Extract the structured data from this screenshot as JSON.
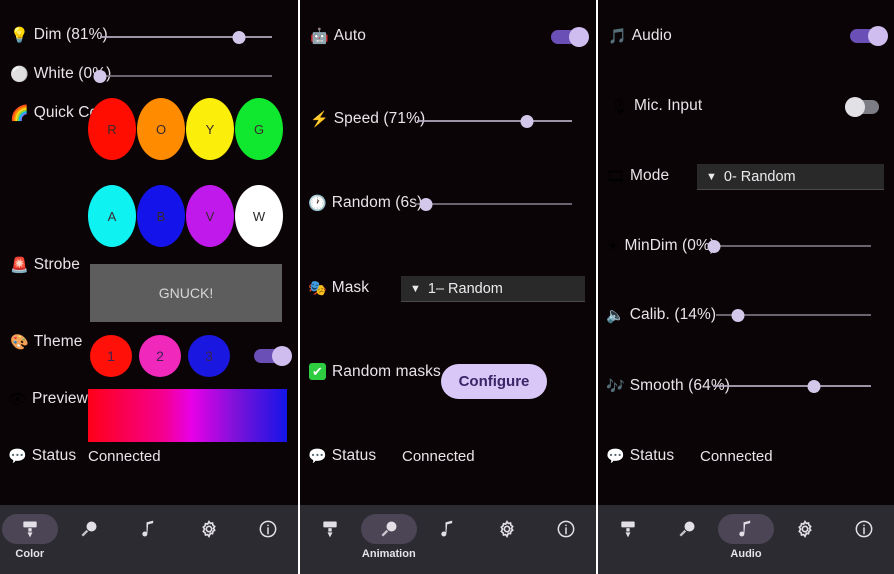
{
  "app": {
    "background": "#0b0406",
    "accent": "#cfbdf0",
    "navbar_bg": "#2c2b31"
  },
  "panels": [
    {
      "id": "color",
      "rows": {
        "dim": {
          "icon": "lightbulb-icon",
          "emoji": "💡",
          "label": "Dim (81%)",
          "value": 81
        },
        "white": {
          "icon": "white-circle-icon",
          "emoji": "⚪",
          "label": "White (0%)",
          "value": 0
        },
        "quick_col": {
          "icon": "rainbow-icon",
          "emoji": "🌈",
          "label": "Quick Col"
        },
        "strobe": {
          "icon": "siren-icon",
          "emoji": "🚨",
          "label": "Strobe",
          "button_label": "GNUCK!",
          "button_color": "#5d5d5d"
        },
        "theme": {
          "icon": "palette-icon",
          "emoji": "🎨",
          "label": "Theme",
          "toggle_on": true
        },
        "preview": {
          "icon": "eye-icon",
          "emoji": "👁",
          "label": "Preview",
          "gradient": [
            "#ff0018",
            "#e800e8",
            "#1414e8"
          ]
        },
        "status": {
          "icon": "speech-bubble-icon",
          "emoji": "💬",
          "label": "Status",
          "value": "Connected"
        }
      },
      "quick_colors": [
        {
          "letter": "R",
          "color": "#ff0d00"
        },
        {
          "letter": "O",
          "color": "#ff8c00"
        },
        {
          "letter": "Y",
          "color": "#fcee0b"
        },
        {
          "letter": "G",
          "color": "#10e830"
        },
        {
          "letter": "A",
          "color": "#0ff2f2"
        },
        {
          "letter": "B",
          "color": "#1414ea"
        },
        {
          "letter": "V",
          "color": "#c019ec"
        },
        {
          "letter": "W",
          "color": "#ffffff"
        }
      ],
      "themes": [
        {
          "label": "1",
          "color": "#ff1008"
        },
        {
          "label": "2",
          "color": "#f028bc"
        },
        {
          "label": "3",
          "color": "#1a18e0"
        }
      ]
    },
    {
      "id": "animation",
      "rows": {
        "auto": {
          "icon": "robot-icon",
          "emoji": "🤖",
          "label": "Auto",
          "toggle_on": true
        },
        "speed": {
          "icon": "lightning-icon",
          "emoji": "⚡",
          "label": "Speed (71%)",
          "value": 71
        },
        "random": {
          "icon": "clock-icon",
          "emoji": "🕐",
          "label": "Random (6s)",
          "value": 6
        },
        "mask": {
          "icon": "masks-icon",
          "emoji": "🎭",
          "label": "Mask",
          "selected": "1– Random"
        },
        "random_masks": {
          "icon": "checkbox-icon",
          "label": "Random masks",
          "checked": true,
          "button_label": "Configure"
        },
        "status": {
          "icon": "speech-bubble-icon",
          "emoji": "💬",
          "label": "Status",
          "value": "Connected"
        }
      }
    },
    {
      "id": "audio",
      "rows": {
        "audio": {
          "icon": "music-note-icon",
          "emoji": "🎵",
          "label": "Audio",
          "toggle_on": true
        },
        "mic": {
          "icon": "microphone-icon",
          "emoji": "🎙",
          "label": "Mic. Input",
          "toggle_on": false
        },
        "mode": {
          "icon": "film-icon",
          "emoji": "🎞",
          "label": "Mode",
          "selected": "0- Random"
        },
        "mindim": {
          "icon": "sun-icon",
          "emoji": "☀",
          "label": "MinDim (0%)",
          "value": 0
        },
        "calib": {
          "icon": "speaker-icon",
          "emoji": "🔈",
          "label": "Calib. (14%)",
          "value": 14
        },
        "smooth": {
          "icon": "music-notes-icon",
          "emoji": "🎶",
          "label": "Smooth (64%)",
          "value": 64
        },
        "status": {
          "icon": "speech-bubble-icon",
          "emoji": "💬",
          "label": "Status",
          "value": "Connected"
        }
      }
    }
  ],
  "navbar": {
    "items": [
      {
        "icon": "brush-icon",
        "label": "Color"
      },
      {
        "icon": "bulbs-icon",
        "label": "Animation"
      },
      {
        "icon": "note-icon",
        "label": "Audio"
      },
      {
        "icon": "gear-icon",
        "label": "Settings"
      },
      {
        "icon": "info-icon",
        "label": "Info"
      }
    ],
    "active": {
      "color": 0,
      "animation": 1,
      "audio": 2
    }
  }
}
